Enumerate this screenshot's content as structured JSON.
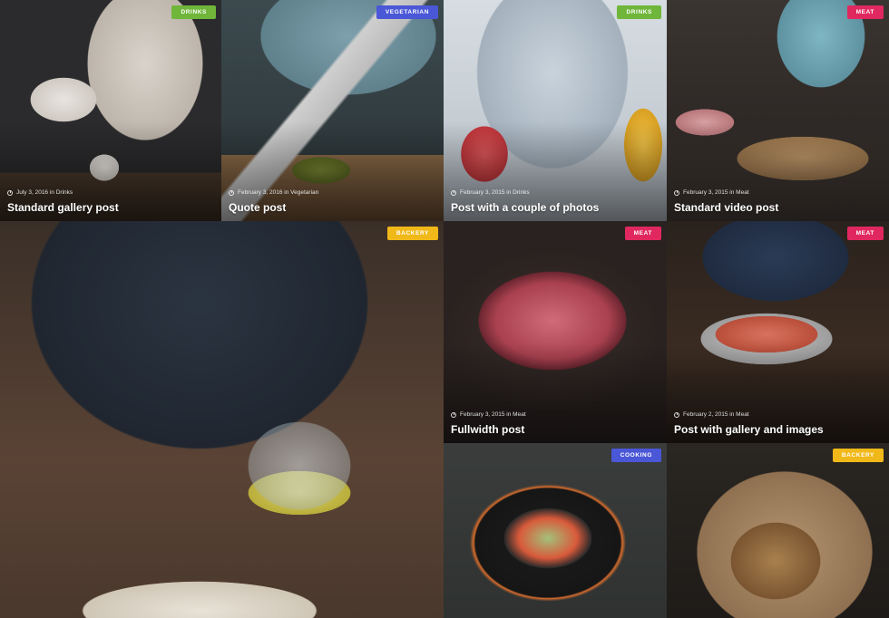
{
  "colors": {
    "drinks": "#6fb63b",
    "vegetarian": "#4a57d6",
    "meat": "#e0285f",
    "backery": "#f0b818",
    "cooking": "#4a57d6"
  },
  "posts": [
    {
      "badge": "Drinks",
      "meta": "July 3, 2016 in Drinks",
      "title": "Standard gallery post"
    },
    {
      "badge": "Vegetarian",
      "meta": "February 3, 2016 in Vegetarian",
      "title": "Quote post"
    },
    {
      "badge": "Drinks",
      "meta": "February 3, 2015 in Drinks",
      "title": "Post with a couple of photos"
    },
    {
      "badge": "Meat",
      "meta": "February 3, 2015 in Meat",
      "title": "Standard video post"
    },
    {
      "badge": "Backery",
      "meta": "",
      "title": ""
    },
    {
      "badge": "Meat",
      "meta": "February 3, 2015 in Meat",
      "title": "Fullwidth post"
    },
    {
      "badge": "Meat",
      "meta": "February 2, 2015 in Meat",
      "title": "Post with gallery and images"
    },
    {
      "badge": "Cooking",
      "meta": "",
      "title": ""
    },
    {
      "badge": "Backery",
      "meta": "",
      "title": ""
    }
  ]
}
